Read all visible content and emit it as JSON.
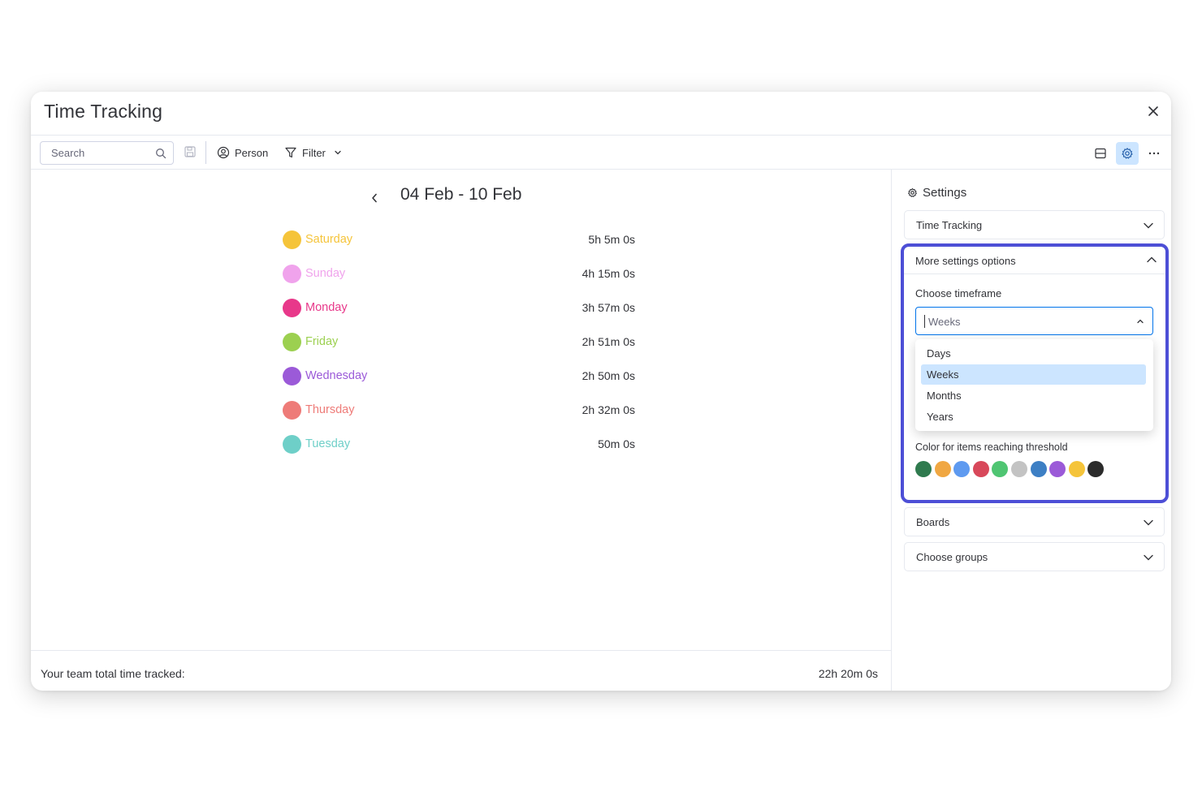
{
  "modal": {
    "title": "Time Tracking"
  },
  "toolbar": {
    "search_placeholder": "Search",
    "person_label": "Person",
    "filter_label": "Filter"
  },
  "main": {
    "date_range": "04 Feb - 10 Feb",
    "days": [
      {
        "name": "Saturday",
        "time": "5h 5m 0s",
        "color": "#f5c43a"
      },
      {
        "name": "Sunday",
        "time": "4h 15m 0s",
        "color": "#f0a3ec"
      },
      {
        "name": "Monday",
        "time": "3h 57m 0s",
        "color": "#e8388a"
      },
      {
        "name": "Friday",
        "time": "2h 51m 0s",
        "color": "#9cd050"
      },
      {
        "name": "Wednesday",
        "time": "2h 50m 0s",
        "color": "#9b5ad8"
      },
      {
        "name": "Thursday",
        "time": "2h 32m 0s",
        "color": "#ee7b78"
      },
      {
        "name": "Tuesday",
        "time": "50m 0s",
        "color": "#6ecfc8"
      }
    ],
    "footer_label": "Your team total time tracked:",
    "footer_total": "22h 20m 0s"
  },
  "settings": {
    "title": "Settings",
    "time_tracking_label": "Time Tracking",
    "more_options_label": "More settings options",
    "timeframe_label": "Choose timeframe",
    "timeframe_value": "Weeks",
    "timeframe_options": [
      "Days",
      "Weeks",
      "Months",
      "Years"
    ],
    "selected_option": "Weeks",
    "threshold_label": "Color for items reaching threshold",
    "threshold_colors": [
      "#2f7a4e",
      "#f0a742",
      "#5e9af0",
      "#d8485a",
      "#4fc572",
      "#c3c3c3",
      "#3d7fc4",
      "#9b5ad8",
      "#f5c43a",
      "#2b2b2b"
    ],
    "boards_label": "Boards",
    "groups_label": "Choose groups"
  },
  "colors": {
    "accent": "#0073ea",
    "highlight_border": "#4d4fd6",
    "selected_bg": "#cce5ff"
  }
}
